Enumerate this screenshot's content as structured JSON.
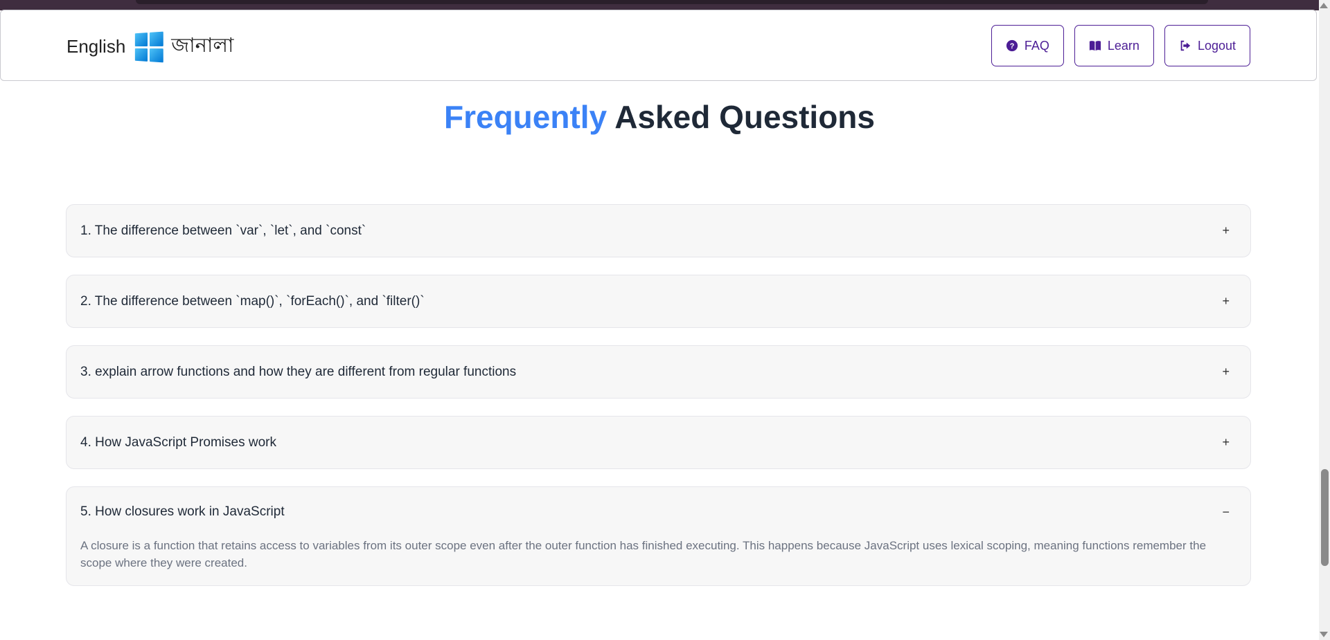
{
  "brand": {
    "left_label": "English",
    "right_label": "জানালা",
    "logo_icon": "windows-logo-icon"
  },
  "nav": {
    "buttons": [
      {
        "label": "FAQ",
        "icon": "question-circle-icon"
      },
      {
        "label": "Learn",
        "icon": "book-open-icon"
      },
      {
        "label": "Logout",
        "icon": "logout-icon"
      }
    ]
  },
  "faq": {
    "title_accent": "Frequently",
    "title_rest": "Asked Questions",
    "items": [
      {
        "question": "1. The difference between `var`, `let`, and `const`",
        "toggle": "+",
        "open": false
      },
      {
        "question": "2. The difference between `map()`, `forEach()`, and `filter()`",
        "toggle": "+",
        "open": false
      },
      {
        "question": "3. explain arrow functions and how they are different from regular functions",
        "toggle": "+",
        "open": false
      },
      {
        "question": "4. How JavaScript Promises work",
        "toggle": "+",
        "open": false
      },
      {
        "question": "5. How closures work in JavaScript",
        "toggle": "−",
        "open": true,
        "answer": "A closure is a function that retains access to variables from its outer scope even after the outer function has finished executing. This happens because JavaScript uses lexical scoping, meaning functions remember the scope where they were created."
      }
    ]
  },
  "colors": {
    "accent": "#3b82f6",
    "button": "#4c1d95"
  }
}
